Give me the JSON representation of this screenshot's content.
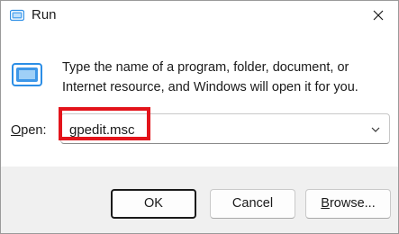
{
  "window": {
    "title": "Run",
    "close_label": "close"
  },
  "description": "Type the name of a program, folder, document, or Internet resource, and Windows will open it for you.",
  "open_field": {
    "label_access_key": "O",
    "label_rest": "pen:",
    "value": "gpedit.msc"
  },
  "buttons": {
    "ok": "OK",
    "cancel": "Cancel",
    "browse_access_key": "B",
    "browse_rest": "rowse..."
  },
  "colors": {
    "highlight": "#e3141b",
    "icon_accent": "#2c8ee6",
    "footer_bg": "#f0f0f0"
  }
}
